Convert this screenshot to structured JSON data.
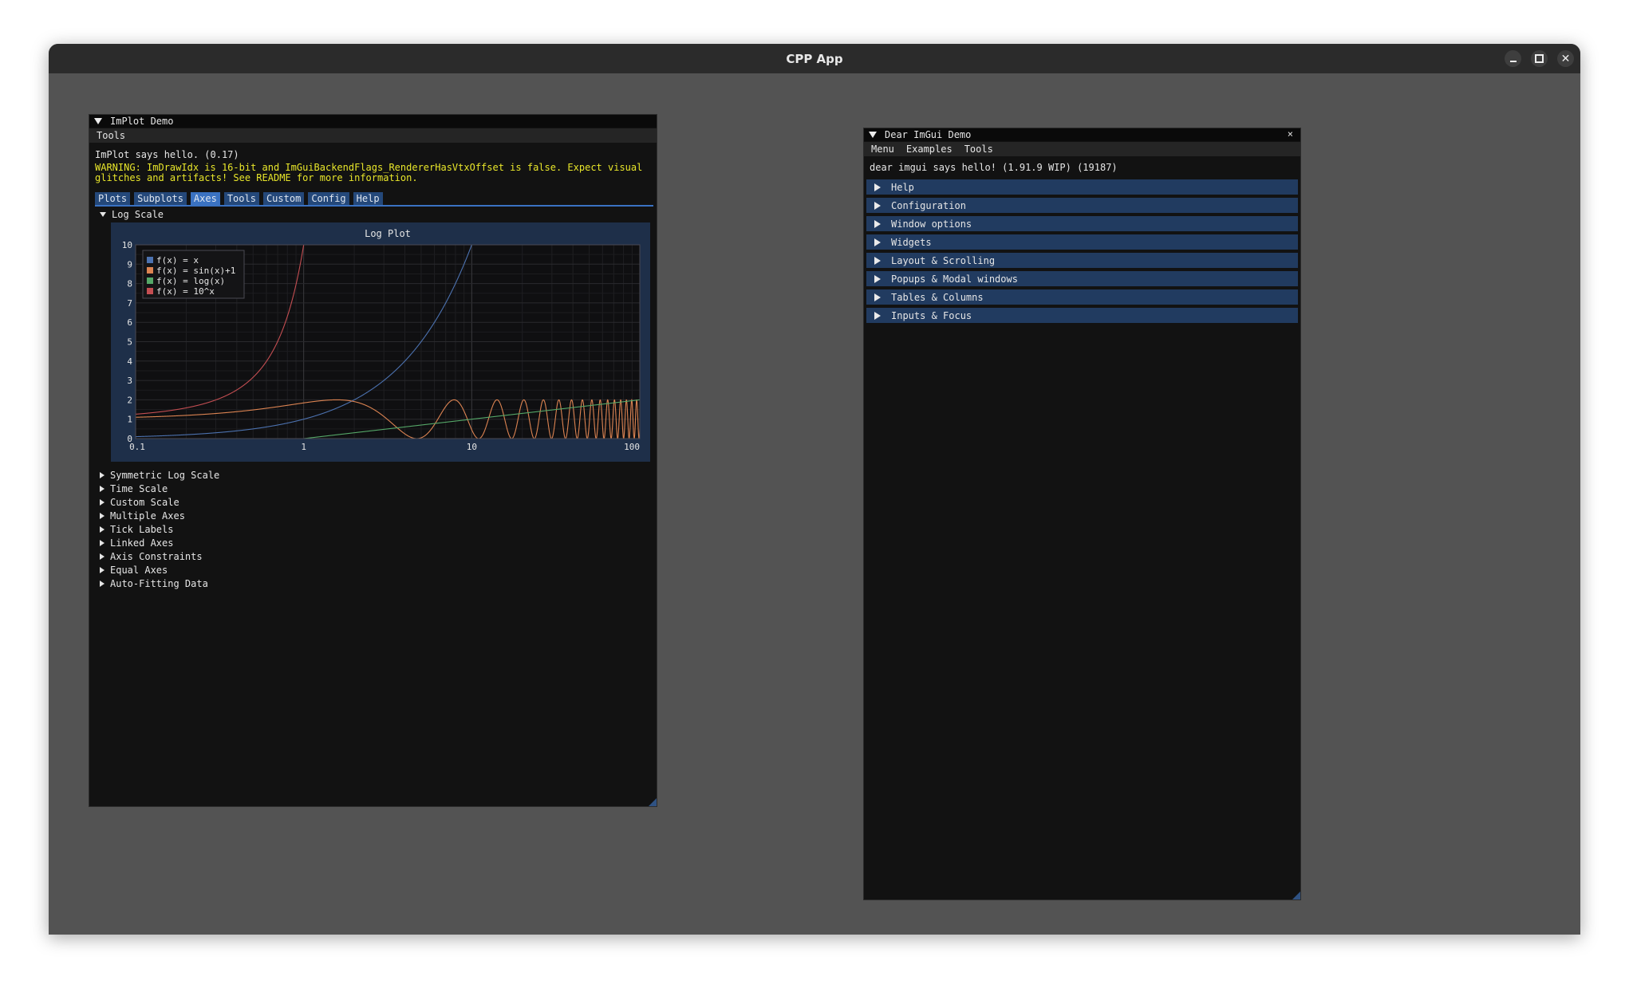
{
  "app": {
    "title": "CPP App"
  },
  "implot_window": {
    "title": "ImPlot Demo",
    "menu": [
      "Tools"
    ],
    "hello_text": "ImPlot says hello. (0.17)",
    "warning_line1": "WARNING: ImDrawIdx is 16-bit and ImGuiBackendFlags_RendererHasVtxOffset is false. Expect visual",
    "warning_line2": "glitches and artifacts! See README for more information.",
    "tabs": [
      {
        "label": "Plots",
        "active": false
      },
      {
        "label": "Subplots",
        "active": false
      },
      {
        "label": "Axes",
        "active": true
      },
      {
        "label": "Tools",
        "active": false
      },
      {
        "label": "Custom",
        "active": false
      },
      {
        "label": "Config",
        "active": false
      },
      {
        "label": "Help",
        "active": false
      }
    ],
    "open_section": "Log Scale",
    "sections": [
      "Symmetric Log Scale",
      "Time Scale",
      "Custom Scale",
      "Multiple Axes",
      "Tick Labels",
      "Linked Axes",
      "Axis Constraints",
      "Equal Axes",
      "Auto-Fitting Data"
    ]
  },
  "chart_data": {
    "type": "line",
    "title": "Log Plot",
    "xscale": "log",
    "xlim": [
      0.1,
      100
    ],
    "ylim": [
      0,
      10
    ],
    "xticks": [
      "0.1",
      "1",
      "10",
      "100"
    ],
    "yticks": [
      "0",
      "1",
      "2",
      "3",
      "4",
      "5",
      "6",
      "7",
      "8",
      "9",
      "10"
    ],
    "grid": true,
    "legend_position": "top-left",
    "series": [
      {
        "name": "f(x) = x",
        "color": "#4c72b0",
        "function": "x"
      },
      {
        "name": "f(x) = sin(x)+1",
        "color": "#dd8452",
        "function": "sin(x)+1"
      },
      {
        "name": "f(x) = log(x)",
        "color": "#55a868",
        "function": "log10(x)"
      },
      {
        "name": "f(x) = 10^x",
        "color": "#c44e52",
        "function": "10^x"
      }
    ]
  },
  "imgui_window": {
    "title": "Dear ImGui Demo",
    "close_glyph": "×",
    "menu": [
      "Menu",
      "Examples",
      "Tools"
    ],
    "hello_text": "dear imgui says hello! (1.91.9 WIP) (19187)",
    "headers": [
      "Help",
      "Configuration",
      "Window options",
      "Widgets",
      "Layout & Scrolling",
      "Popups & Modal windows",
      "Tables & Columns",
      "Inputs & Focus"
    ]
  }
}
